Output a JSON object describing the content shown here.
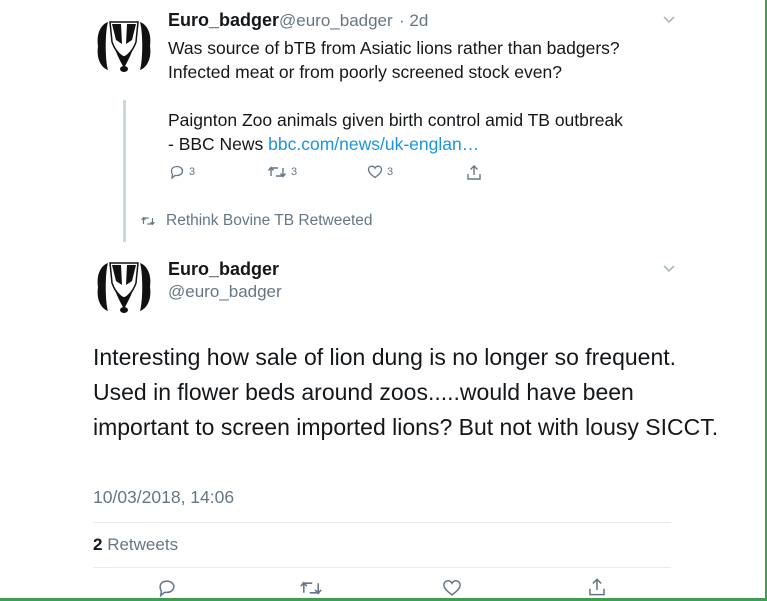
{
  "tweet1": {
    "display_name": "Euro_badger",
    "handle": "@euro_badger",
    "time": "· 2d",
    "text_lines": [
      "Was source of bTB from Asiatic lions rather than badgers?",
      "Infected meat or from poorly screened stock even?",
      "",
      "Paignton Zoo animals given birth control amid TB outbreak",
      "- BBC News "
    ],
    "link": "bbc.com/news/uk-englan…",
    "reply_count": "3",
    "retweet_count": "3",
    "like_count": "3"
  },
  "retweet_notice": {
    "label": "Rethink Bovine TB Retweeted"
  },
  "tweet2": {
    "display_name": "Euro_badger",
    "handle": "@euro_badger",
    "text": "Interesting how sale of lion dung is no longer so frequent. Used in flower beds around zoos.....would have been important to screen imported lions? But not with lousy SICCT.",
    "timestamp": "10/03/2018, 14:06",
    "retweet_count": "2",
    "retweets_label": "Retweets"
  },
  "icons": [
    "badger-avatar-icon",
    "chevron-down-icon",
    "reply-icon",
    "retweet-icon",
    "like-icon",
    "share-icon"
  ],
  "colors": {
    "link": "#1b95e0",
    "muted": "#657786",
    "text": "#14171a",
    "frame": "#3f9e4f"
  }
}
